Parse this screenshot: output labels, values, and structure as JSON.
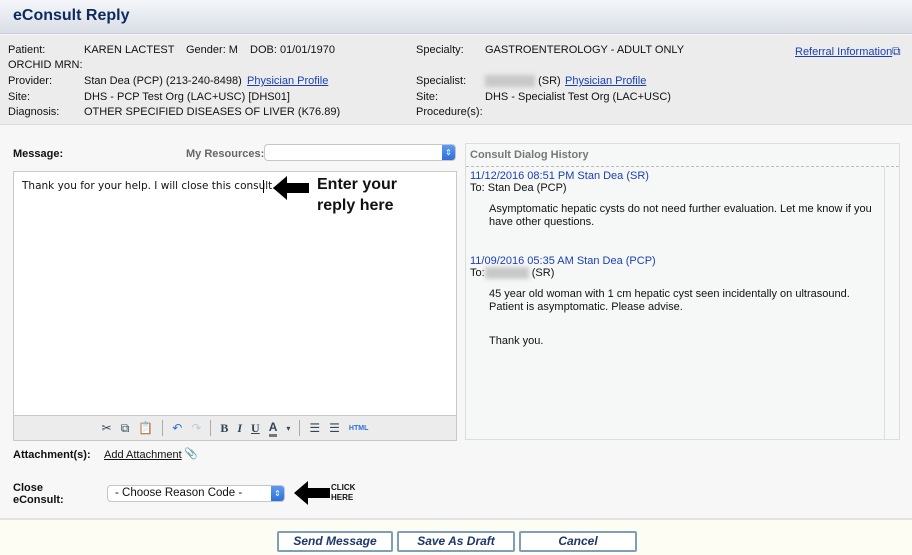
{
  "header": {
    "title": "eConsult Reply"
  },
  "info": {
    "patient_label": "Patient:",
    "patient": "KAREN LACTEST",
    "gender": "Gender: M",
    "dob": "DOB: 01/01/1970",
    "mrn_label": "ORCHID MRN:",
    "provider_label": "Provider:",
    "provider": "Stan Dea (PCP) (213-240-8498)",
    "provider_profile": "Physician Profile",
    "site_label": "Site:",
    "site": "DHS - PCP Test Org (LAC+USC) [DHS01]",
    "diagnosis_label": "Diagnosis:",
    "diagnosis": "OTHER SPECIFIED DISEASES OF LIVER (K76.89)",
    "specialty_label": "Specialty:",
    "specialty": "GASTROENTEROLOGY - ADULT ONLY",
    "specialist_label": "Specialist:",
    "specialist_suffix": "(SR)",
    "specialist_profile": "Physician Profile",
    "spec_site_label": "Site:",
    "spec_site": "DHS - Specialist Test Org (LAC+USC)",
    "procedure_label": "Procedure(s):",
    "referral_link": "Referral Information"
  },
  "message": {
    "label": "Message:",
    "resources_label": "My Resources:",
    "resources_value": "",
    "text": "Thank you for your help.  I will close this consult.",
    "annotation": "Enter your reply here"
  },
  "toolbar": [
    "cut",
    "copy",
    "paste",
    "undo",
    "redo",
    "bold",
    "italic",
    "underline",
    "font-color",
    "bullet-list",
    "numbered-list",
    "html"
  ],
  "history": {
    "title": "Consult Dialog History",
    "messages": [
      {
        "header": "11/12/2016 08:51 PM Stan Dea (SR)",
        "to": "To: Stan Dea (PCP)",
        "body": [
          "Asymptomatic hepatic cysts do not need further evaluation. Let me know if you have other questions."
        ]
      },
      {
        "header": "11/09/2016 05:35 AM Stan Dea (PCP)",
        "to_prefix": "To:",
        "to_suffix": "(SR)",
        "body": [
          "45 year old woman with 1 cm hepatic cyst seen incidentally on ultrasound. Patient is asymptomatic. Please advise.",
          "Thank you."
        ]
      }
    ]
  },
  "attachment": {
    "label": "Attachment(s):",
    "link": "Add Attachment"
  },
  "close": {
    "label": "Close eConsult:",
    "select_value": "- Choose Reason Code -",
    "annotation": "CLICK HERE"
  },
  "buttons": {
    "send": "Send Message",
    "draft": "Save As Draft",
    "cancel": "Cancel"
  }
}
